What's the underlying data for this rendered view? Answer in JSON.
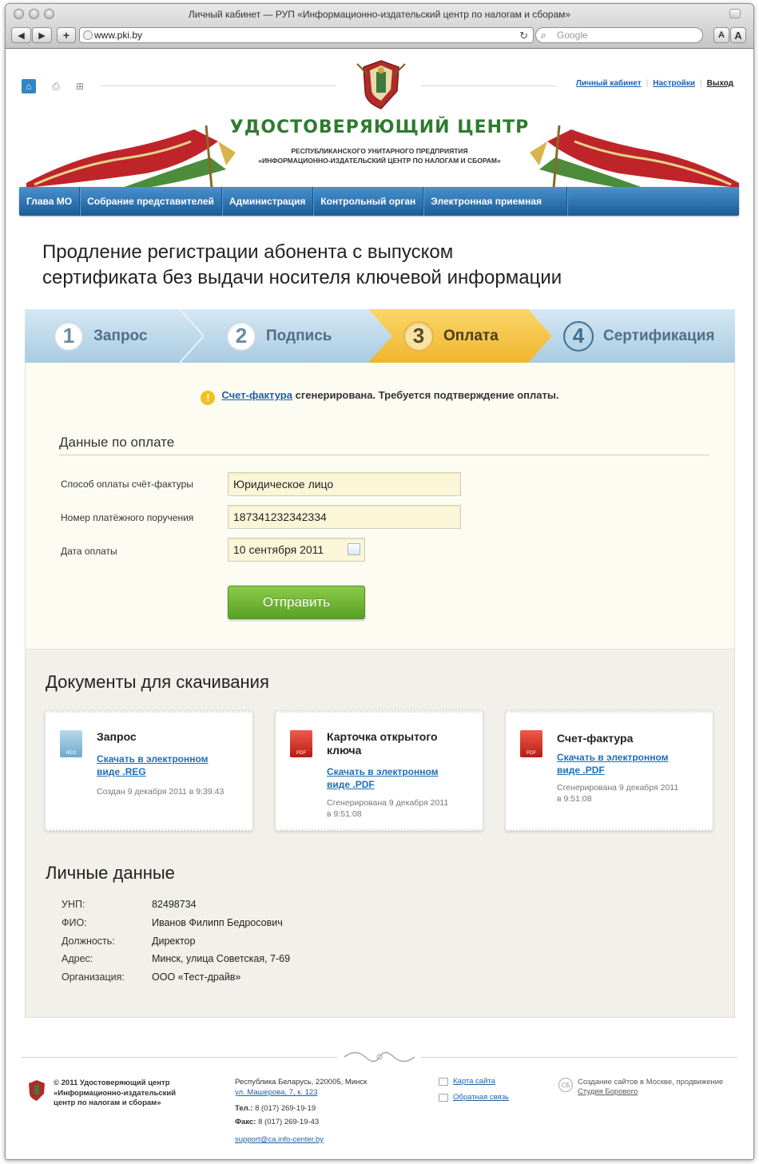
{
  "window": {
    "title": "Личный кабинет — РУП «Информационно-издательский центр по налогам и сборам»",
    "url": "www.pki.by",
    "search_placeholder": "Google",
    "font_small": "A",
    "font_large": "A"
  },
  "header": {
    "toplinks": {
      "cabinet": "Личный кабинет",
      "settings": "Настройки",
      "exit": "Выход"
    },
    "brand_title": "УДОСТОВЕРЯЮЩИЙ ЦЕНТР",
    "brand_sub_1": "РЕСПУБЛИКАНСКОГО УНИТАРНОГО ПРЕДПРИЯТИЯ",
    "brand_sub_2": "«ИНФОРМАЦИОННО-ИЗДАТЕЛЬСКИЙ ЦЕНТР ПО НАЛОГАМ И СБОРАМ»"
  },
  "nav": {
    "items": [
      "Глава МО",
      "Собрание представителей",
      "Администрация",
      "Контрольный орган",
      "Электронная приемная"
    ]
  },
  "page": {
    "title_line1": "Продление регистрации абонента с выпуском",
    "title_line2": "сертификата без выдачи носителя ключевой информации"
  },
  "steps": [
    {
      "num": "1",
      "label": "Запрос"
    },
    {
      "num": "2",
      "label": "Подпись"
    },
    {
      "num": "3",
      "label": "Оплата"
    },
    {
      "num": "4",
      "label": "Сертификация"
    }
  ],
  "payment": {
    "notice_link": "Счет-фактура",
    "notice_text": " сгенерирована. Требуется подтверждение оплаты.",
    "section_title": "Данные по оплате",
    "method_label": "Способ оплаты счёт-фактуры",
    "method_value": "Юридическое лицо",
    "order_label": "Номер платёжного поручения",
    "order_value": "187341232342334",
    "date_label": "Дата оплаты",
    "date_value": "10 сентября 2011",
    "submit": "Отправить"
  },
  "documents": {
    "title": "Документы для скачивания",
    "items": [
      {
        "name": "Запрос",
        "link_1": "Скачать в электронном",
        "link_2": "виде .REG",
        "meta_1": "Создан 9 декабря 2011 в 9:39:43",
        "meta_2": "",
        "icon_text": "REG"
      },
      {
        "name_1": "Карточка открытого",
        "name_2": "ключа",
        "link_1": "Скачать в электронном",
        "link_2": "виде .PDF",
        "meta_1": "Сгенерирована 9 декабря 2011",
        "meta_2": "в 9:51:08",
        "icon_text": "PDF"
      },
      {
        "name": "Счет-фактура",
        "link_1": "Скачать в электронном",
        "link_2": "виде .PDF",
        "meta_1": "Сгенерирована 9 декабря 2011",
        "meta_2": "в 9:51:08",
        "icon_text": "PDF"
      }
    ]
  },
  "personal": {
    "title": "Личные данные",
    "rows": [
      {
        "label": "УНП:",
        "value": "82498734"
      },
      {
        "label": "ФИО:",
        "value": "Иванов Филипп Бедросович"
      },
      {
        "label": "Должность:",
        "value": "Директор"
      },
      {
        "label": "Адрес:",
        "value": "Минск, улица Советская, 7-69"
      },
      {
        "label": "Организация:",
        "value": "ООО «Тест-драйв»"
      }
    ]
  },
  "footer": {
    "copy_1": "© 2011  Удостоверяющий центр",
    "copy_2": "«Информационно-издательский",
    "copy_3": "центр по налогам и сборам»",
    "addr_1": "Республика Беларусь, 220005, Минск",
    "addr_2": "ул. Машерова, 7, к. 123",
    "tel_label": "Тел.:",
    "tel": " 8 (017) 269-19-19",
    "fax_label": "Факс:",
    "fax": " 8 (017) 269-19-43",
    "email": "support@ca.info-center.by",
    "sitemap": "Карта сайта",
    "feedback": "Обратная связь",
    "studio_1": "Создание сайтов в Москве, продвижение",
    "studio_2": "Студия Борового"
  },
  "colors": {
    "accent": "#2f87c8",
    "nav": "#1c5b97",
    "brand": "#2f7a2f",
    "active_step": "#f0b52d",
    "submit": "#58a124"
  }
}
